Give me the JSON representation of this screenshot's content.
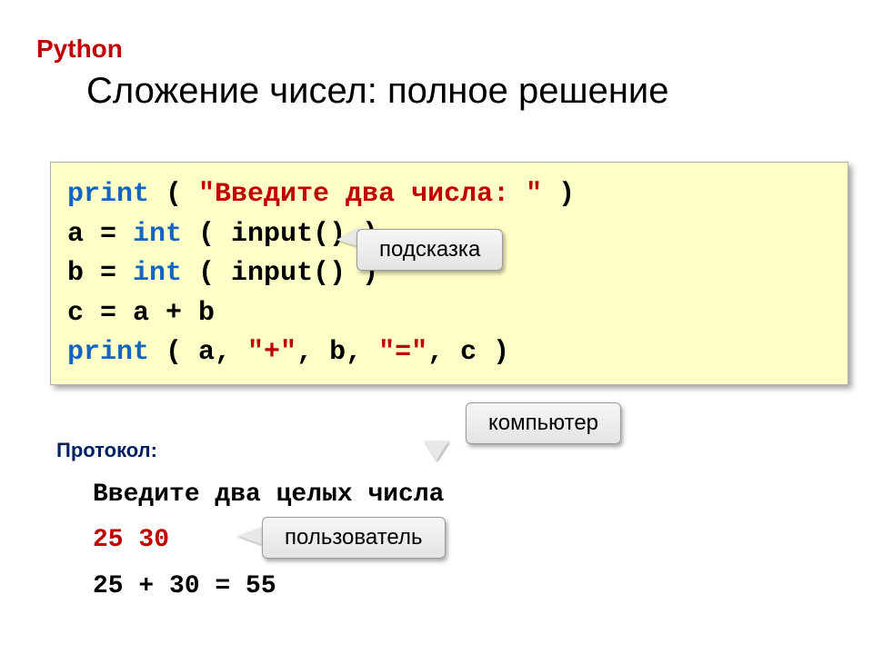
{
  "language_label": "Python",
  "title": "Сложение чисел: полное решение",
  "code": {
    "l1_kw": "print",
    "l1_paren_open": " ( ",
    "l1_str": "\"Введите два числа: \"",
    "l1_paren_close": " )",
    "l2_a": "a",
    "l2_eq": " = ",
    "l2_kw": "int",
    "l2_rest": " ( input() )",
    "l3_a": "b",
    "l3_eq": " = ",
    "l3_kw": "int",
    "l3_rest": " ( input() )",
    "l4": "c = a + b",
    "l5_kw": "print",
    "l5_open": " ( a, ",
    "l5_str1": "\"+\"",
    "l5_mid": ", b, ",
    "l5_str2": "\"=\"",
    "l5_close": ", c )"
  },
  "callouts": {
    "hint": "подсказка",
    "computer": "компьютер",
    "user": "пользователь"
  },
  "protocol_label": "Протокол:",
  "protocol": {
    "prompt": "Введите два целых числа",
    "input": "25 30",
    "output": "25 + 30 = 55"
  }
}
